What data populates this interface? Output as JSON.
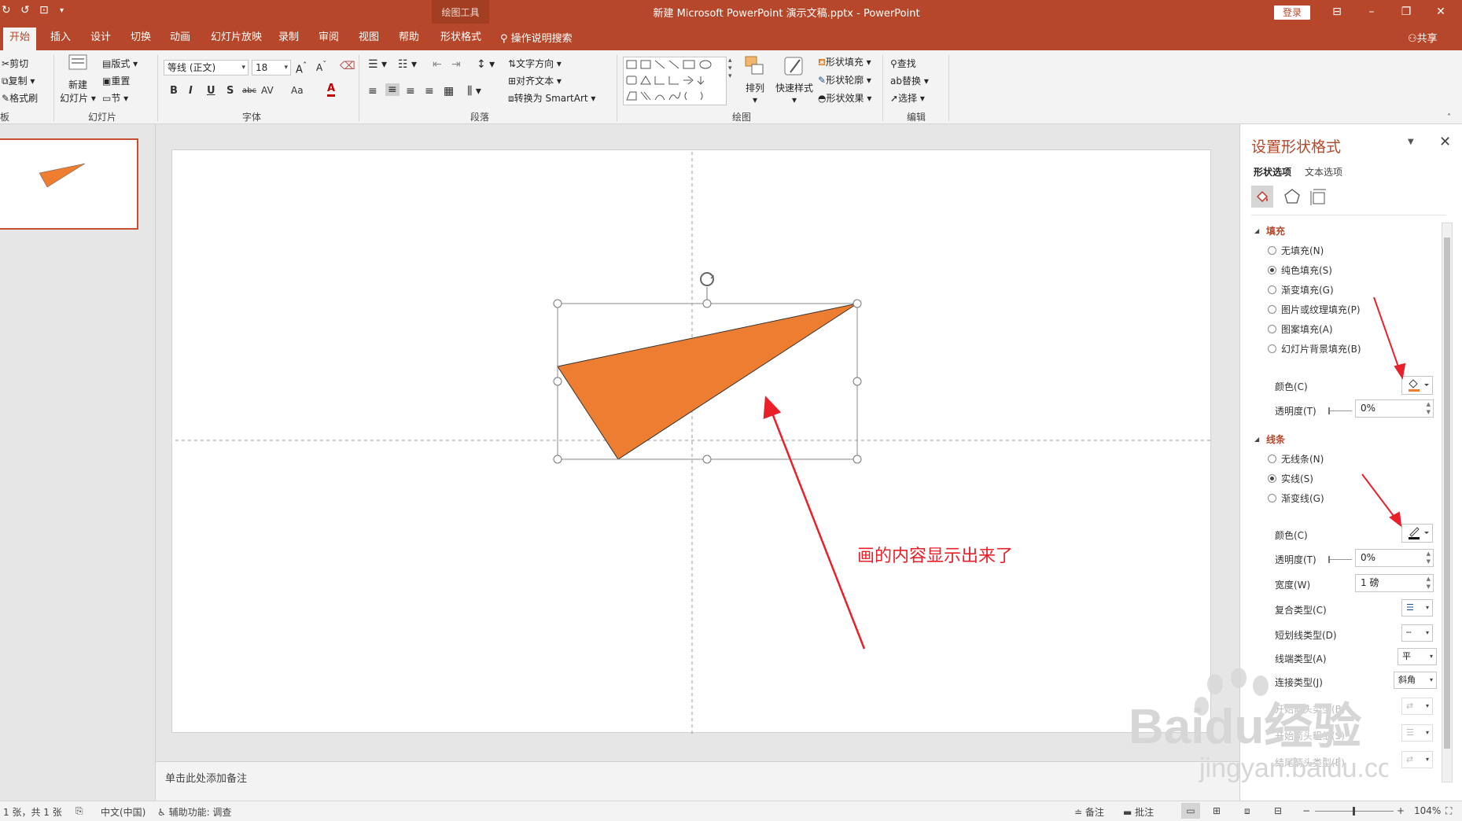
{
  "titlebar": {
    "contextual_group": "绘图工具",
    "doc_title": "新建 Microsoft PowerPoint 演示文稿.pptx  -  PowerPoint",
    "login": "登录"
  },
  "tabs": [
    "开始",
    "插入",
    "设计",
    "切换",
    "动画",
    "幻灯片放映",
    "录制",
    "审阅",
    "视图",
    "帮助",
    "形状格式"
  ],
  "tell_me": "操作说明搜索",
  "share": "共享",
  "ribbon": {
    "clipboard": {
      "cut": "剪切",
      "copy": "复制",
      "painter": "格式刷",
      "label": "板"
    },
    "slides": {
      "new_slide": "新建",
      "new_slide_2": "幻灯片",
      "layout": "版式",
      "reset": "重置",
      "section": "节",
      "label": "幻灯片"
    },
    "font": {
      "name": "等线 (正文)",
      "size": "18",
      "label": "字体",
      "bold": "B",
      "italic": "I",
      "underline": "U",
      "shadow": "S",
      "strike": "abc",
      "spacing": "AV",
      "case": "Aa",
      "color": "A"
    },
    "paragraph": {
      "text_direction": "文字方向",
      "align_text": "对齐文本",
      "smartart": "转换为 SmartArt",
      "label": "段落"
    },
    "drawing": {
      "arrange": "排列",
      "quick_styles": "快速样式",
      "fill": "形状填充",
      "outline": "形状轮廓",
      "effects": "形状效果",
      "label": "绘图"
    },
    "editing": {
      "find": "查找",
      "replace": "替换",
      "select": "选择",
      "label": "编辑"
    }
  },
  "slide": {
    "annotation": "画的内容显示出来了"
  },
  "notes_placeholder": "单击此处添加备注",
  "format_pane": {
    "title": "设置形状格式",
    "tab_shape": "形状选项",
    "tab_text": "文本选项",
    "fill_section": "填充",
    "fill_options": [
      "无填充(N)",
      "纯色填充(S)",
      "渐变填充(G)",
      "图片或纹理填充(P)",
      "图案填充(A)",
      "幻灯片背景填充(B)"
    ],
    "fill_selected": 1,
    "fill_color_label": "颜色(C)",
    "fill_transparency_label": "透明度(T)",
    "fill_transparency_value": "0%",
    "line_section": "线条",
    "line_options": [
      "无线条(N)",
      "实线(S)",
      "渐变线(G)"
    ],
    "line_selected": 1,
    "line_color_label": "颜色(C)",
    "line_transparency_label": "透明度(T)",
    "line_transparency_value": "0%",
    "width_label": "宽度(W)",
    "width_value": "1 磅",
    "compound_label": "复合类型(C)",
    "dash_label": "短划线类型(D)",
    "cap_label": "线端类型(A)",
    "cap_value": "平",
    "join_label": "连接类型(J)",
    "join_value": "斜角",
    "begin_arrow_type_label": "开始箭头类型(B)",
    "begin_arrow_size_label": "开始箭头粗细(S)",
    "end_arrow_type_label": "结尾箭头类型(E)"
  },
  "statusbar": {
    "slide_count": "1 张，共 1 张",
    "language": "中文(中国)",
    "accessibility": "辅助功能: 调查",
    "notes": "备注",
    "comments": "批注",
    "zoom": "104%"
  },
  "watermark": {
    "brand": "Baidu经验",
    "url": "jingyan.baidu.com"
  },
  "colors": {
    "accent": "#b7472a",
    "shape_fill": "#ed7d31",
    "annotation_red": "#e8202a"
  }
}
